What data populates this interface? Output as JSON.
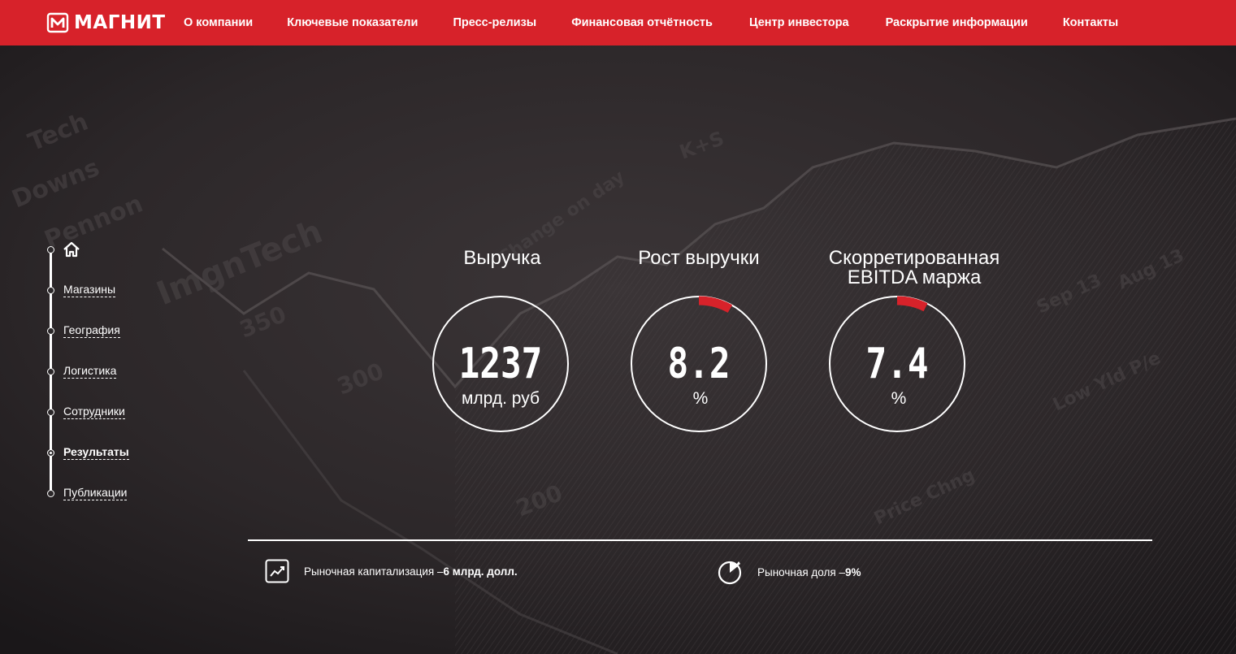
{
  "brand": {
    "name": "МАГНИТ",
    "accent": "#d7222a",
    "logo_icon": "magnit-m-icon"
  },
  "nav": {
    "items": [
      "О компании",
      "Ключевые показатели",
      "Пресс-релизы",
      "Финансовая отчётность",
      "Центр инвестора",
      "Раскрытие информации",
      "Контакты"
    ]
  },
  "sidenav": {
    "home_icon": "home-icon",
    "items": [
      "Магазины",
      "География",
      "Логистика",
      "Сотрудники",
      "Результаты",
      "Публикации"
    ],
    "active": "Результаты"
  },
  "metrics": [
    {
      "title": "Выручка",
      "value": "1237",
      "unit": "млрд. руб"
    },
    {
      "title": "Рост выручки",
      "value": "8.2",
      "unit": "%",
      "fraction": 0.082
    },
    {
      "title": "Скорретированная EBITDA маржа",
      "value": "7.4",
      "unit": "%",
      "fraction": 0.074
    }
  ],
  "footer": {
    "left": {
      "icon": "trend-chart-icon",
      "label": "Рыночная капитализация – ",
      "value": "6 млрд. долл."
    },
    "right": {
      "icon": "pie-share-icon",
      "label": "Рыночная доля – ",
      "value": "9%"
    }
  }
}
